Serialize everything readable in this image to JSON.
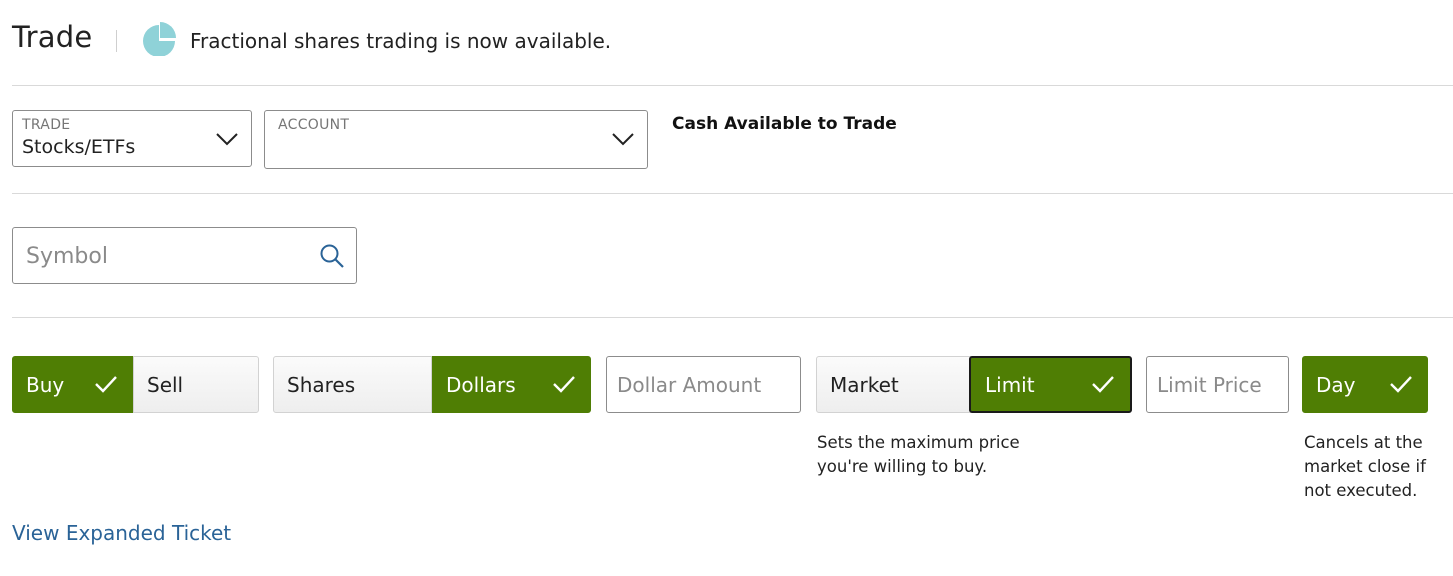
{
  "header": {
    "title": "Trade",
    "announcement": "Fractional shares trading is now available."
  },
  "colors": {
    "accent_green": "#4f7e04",
    "pie_icon": "#8fd2d8",
    "link_blue": "#2a6397"
  },
  "trade_dropdown": {
    "label": "TRADE",
    "value": "Stocks/ETFs",
    "icon": "chevron-down-icon"
  },
  "account_dropdown": {
    "label": "ACCOUNT",
    "value": "",
    "icon": "chevron-down-icon"
  },
  "cash": {
    "label": "Cash Available to Trade"
  },
  "symbol": {
    "placeholder": "Symbol",
    "value": "",
    "icon": "search-icon"
  },
  "action": {
    "buy": "Buy",
    "sell": "Sell",
    "selected": "Buy"
  },
  "quantity_type": {
    "shares": "Shares",
    "dollars": "Dollars",
    "selected": "Dollars"
  },
  "amount": {
    "placeholder": "Dollar Amount",
    "value": ""
  },
  "order_type": {
    "market": "Market",
    "limit": "Limit",
    "selected": "Limit",
    "help": "Sets the maximum price\nyou're willing to buy."
  },
  "limit_price": {
    "placeholder": "Limit Price",
    "value": ""
  },
  "time_in_force": {
    "day": "Day",
    "selected": "Day",
    "help": "Cancels at the\nmarket close if\nnot executed."
  },
  "footer": {
    "link": "View Expanded Ticket"
  }
}
